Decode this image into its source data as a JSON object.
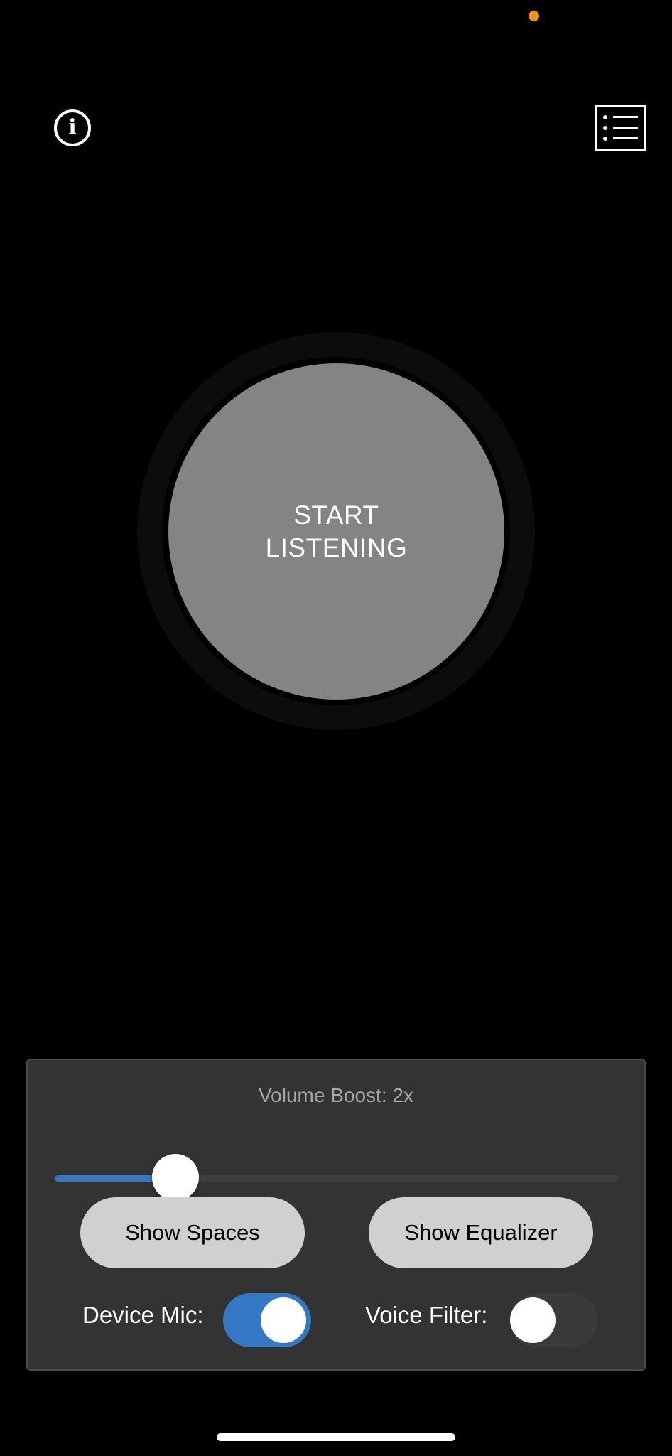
{
  "status_bar": {
    "recording_indicator_color": "#f5901e"
  },
  "header": {
    "info_icon": "info-circle-icon",
    "info_glyph": "i",
    "menu_icon": "list-menu-icon"
  },
  "main": {
    "start_label": "START\nLISTENING"
  },
  "controls": {
    "volume_label": "Volume Boost: 2x",
    "volume_slider_fraction": 0.215,
    "show_spaces_label": "Show Spaces",
    "show_equalizer_label": "Show Equalizer",
    "device_mic_label": "Device Mic:",
    "device_mic_on": true,
    "voice_filter_label": "Voice Filter:",
    "voice_filter_on": false
  },
  "colors": {
    "accent": "#3478c6",
    "button_gray": "#848484",
    "panel_bg": "#333333"
  }
}
